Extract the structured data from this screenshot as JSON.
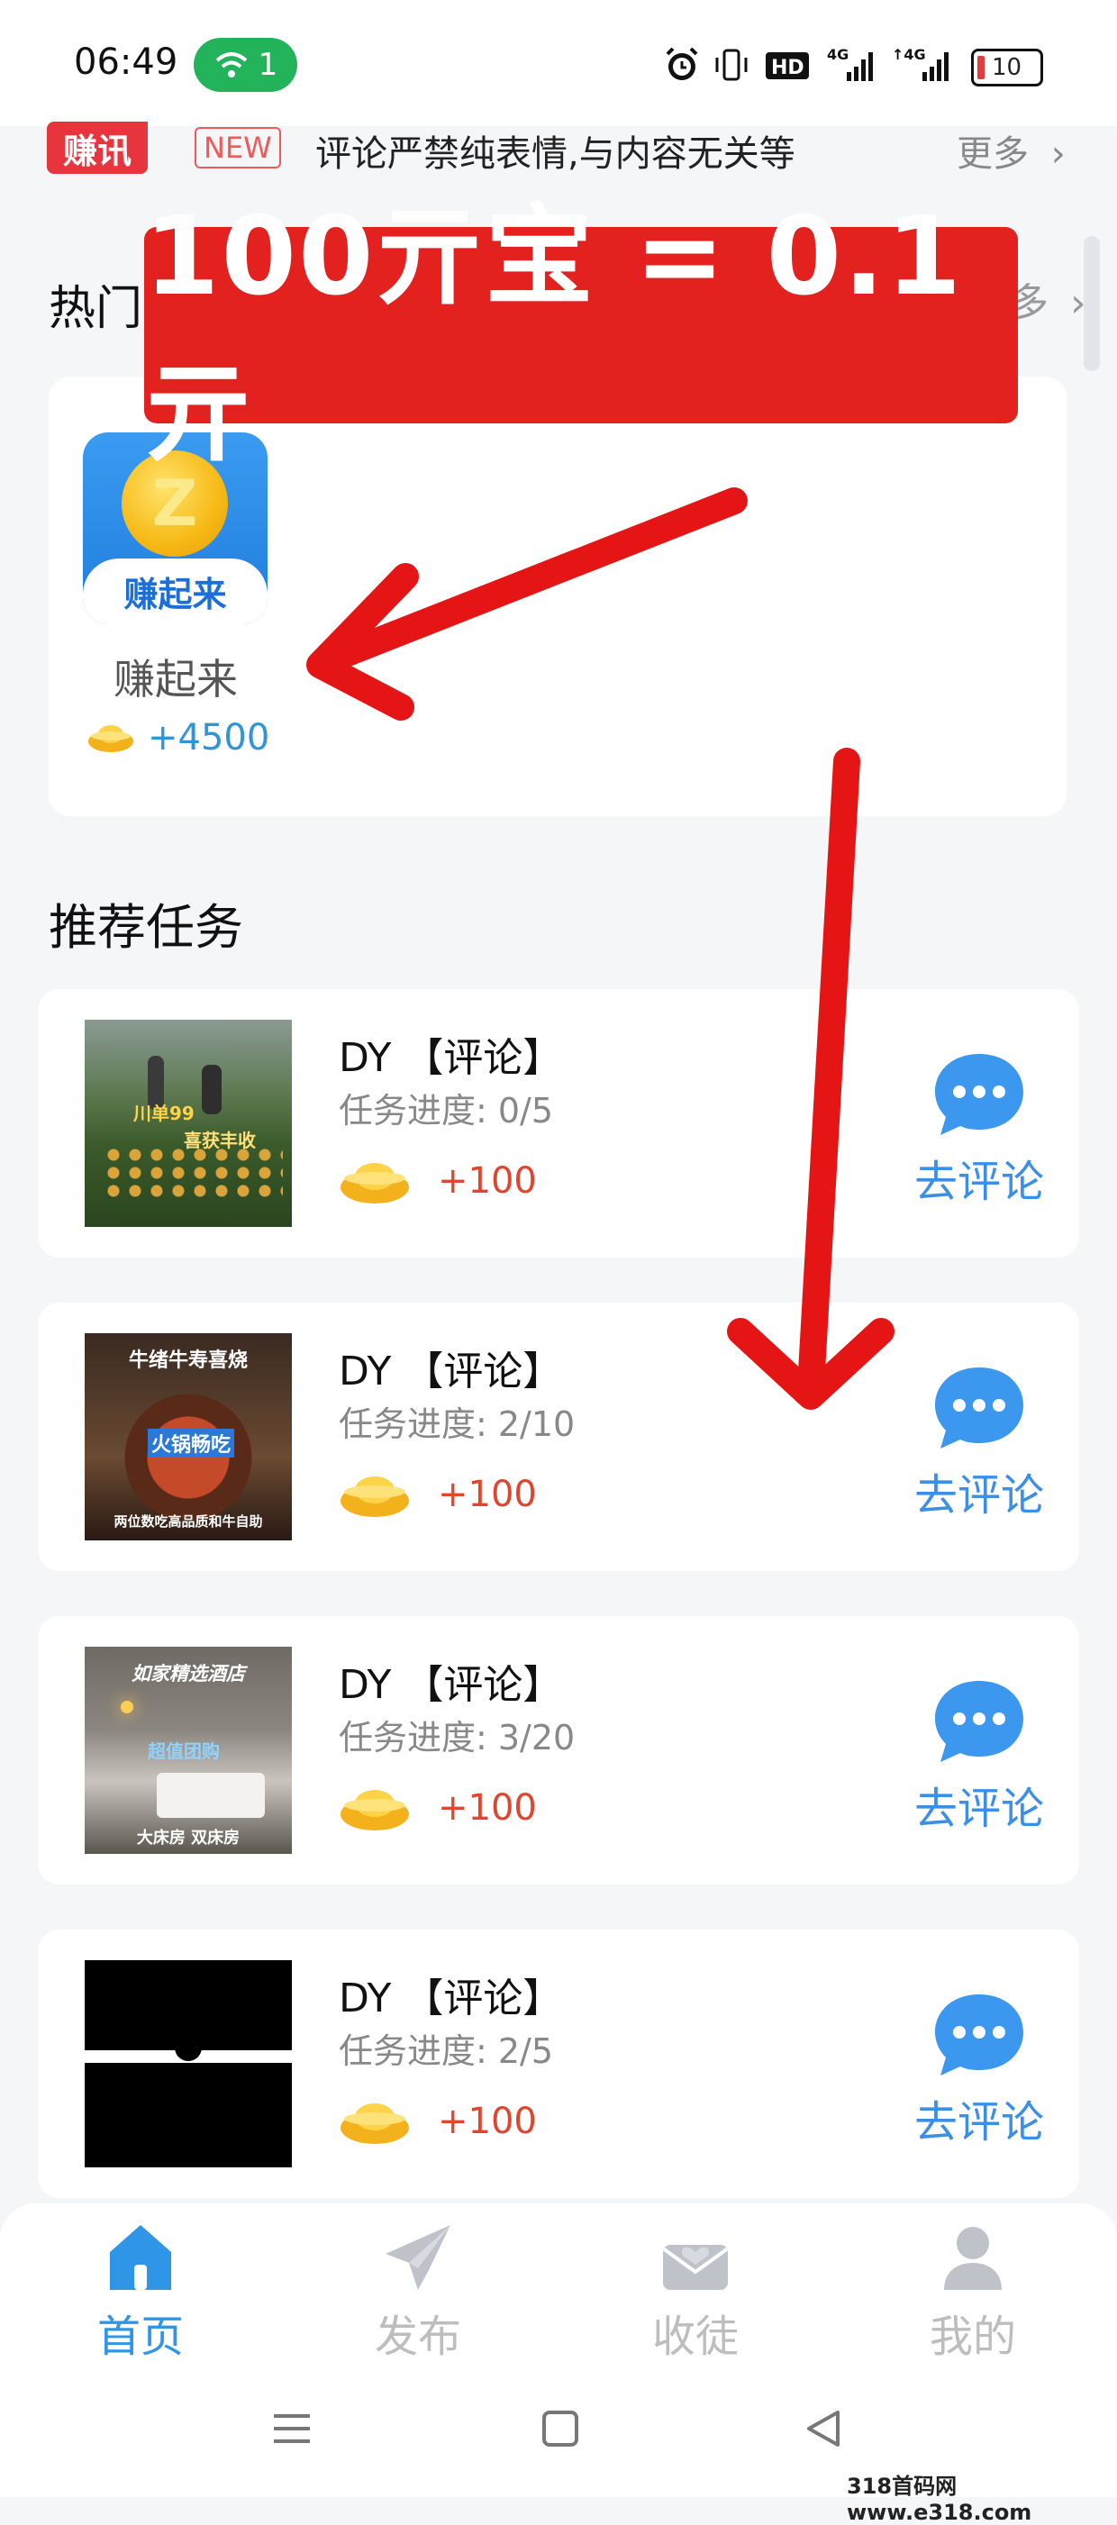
{
  "status_bar": {
    "time": "06:49",
    "hotspot_count": "1",
    "battery": "10"
  },
  "ticker": {
    "badge": "赚讯",
    "new_tag": "NEW",
    "text": "评论严禁纯表情,与内容无关等",
    "more": "更多"
  },
  "hot": {
    "title": "热门",
    "more": "多",
    "app": {
      "icon_text": "赚起来",
      "icon_letter": "Z",
      "name": "赚起来",
      "reward": "+4500"
    }
  },
  "banner": "100亓宝 = 0.1亓",
  "recommended": {
    "title": "推荐任务",
    "tasks": [
      {
        "title": "DY 【评论】",
        "progress": "任务进度: 0/5",
        "reward": "+100",
        "action": "去评论",
        "thumb_caption_1": "川单99",
        "thumb_caption_2": "喜获丰收"
      },
      {
        "title": "DY 【评论】",
        "progress": "任务进度: 2/10",
        "reward": "+100",
        "action": "去评论",
        "thumb_caption_1": "牛绪牛寿喜烧",
        "thumb_caption_2": "火锅畅吃",
        "thumb_caption_3": "两位数吃高品质和牛自助"
      },
      {
        "title": "DY 【评论】",
        "progress": "任务进度: 3/20",
        "reward": "+100",
        "action": "去评论",
        "thumb_caption_1": "如家精选酒店",
        "thumb_caption_2": "超值团购",
        "thumb_caption_3": "大床房 双床房"
      },
      {
        "title": "DY 【评论】",
        "progress": "任务进度: 2/5",
        "reward": "+100",
        "action": "去评论"
      }
    ]
  },
  "bottom_nav": {
    "items": [
      {
        "label": "首页",
        "icon": "home-icon",
        "active": true
      },
      {
        "label": "发布",
        "icon": "paper-plane-icon",
        "active": false
      },
      {
        "label": "收徒",
        "icon": "envelope-heart-icon",
        "active": false
      },
      {
        "label": "我的",
        "icon": "person-icon",
        "active": false
      }
    ]
  },
  "colors": {
    "accent": "#3b8fe6",
    "reward": "#e0452f",
    "banner": "#e3211f",
    "hotspot": "#23b35a"
  },
  "watermark": "318首码网 www.e318.com"
}
